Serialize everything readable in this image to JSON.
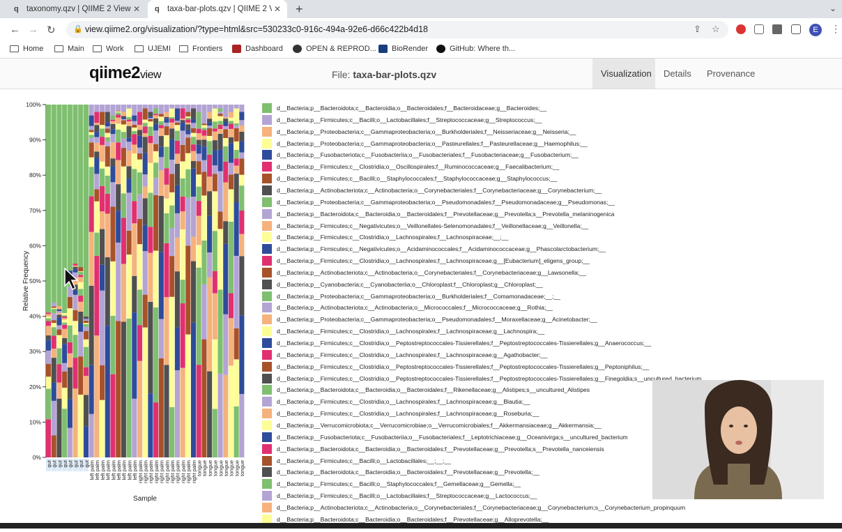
{
  "browser": {
    "tabs": [
      {
        "title": "taxonomy.qzv | QIIME 2 View",
        "icon": "q2-favicon"
      },
      {
        "title": "taxa-bar-plots.qzv | QIIME 2 Vi",
        "icon": "q2-favicon"
      }
    ],
    "url": "view.qiime2.org/visualization/?type=html&src=530233c0-916c-494a-92e6-d66c422b4d18",
    "profile_initial": "E",
    "bookmarks": [
      "Home",
      "Main",
      "Work",
      "UJEMI",
      "Frontiers",
      "Dashboard",
      "OPEN & REPROD...",
      "BioRender",
      "GitHub: Where th..."
    ]
  },
  "qiime": {
    "logo_main": "qiime2",
    "logo_sub": "view",
    "file_prefix": "File:",
    "file_name": "taxa-bar-plots.qzv",
    "nav": [
      "Visualization",
      "Details",
      "Provenance"
    ]
  },
  "chart_data": {
    "type": "bar",
    "stacked": true,
    "xlabel": "Sample",
    "ylabel": "Relative Frequency",
    "yticks": [
      "0%",
      "10%",
      "20%",
      "30%",
      "40%",
      "50%",
      "60%",
      "70%",
      "80%",
      "90%",
      "100%"
    ],
    "ylim": [
      0,
      100
    ],
    "categories": [
      "gut",
      "gut",
      "gut",
      "gut",
      "gut",
      "gut",
      "gut",
      "gut",
      "left palm",
      "left palm",
      "left palm",
      "left palm",
      "left palm",
      "left palm",
      "left palm",
      "left palm",
      "left palm",
      "right palm",
      "right palm",
      "right palm",
      "right palm",
      "right palm",
      "right palm",
      "right palm",
      "right palm",
      "right palm",
      "right palm",
      "right palm",
      "tongue",
      "tongue",
      "tongue",
      "tongue",
      "tongue",
      "tongue",
      "tongue",
      "tongue",
      "tongue"
    ],
    "top_taxon_share": [
      58,
      56,
      57,
      59,
      47,
      45,
      46,
      60,
      3,
      2,
      2,
      2,
      3,
      1,
      2,
      1,
      3,
      2,
      1,
      2,
      1,
      1,
      2,
      1,
      1,
      1,
      2,
      1,
      2,
      4,
      2,
      1,
      1,
      1,
      2,
      1,
      2
    ]
  },
  "legend": [
    {
      "color": "#7fbf6f",
      "label": "d__Bacteria;p__Bacteroidota;c__Bacteroidia;o__Bacteroidales;f__Bacteroidaceae;g__Bacteroides;__"
    },
    {
      "color": "#b3a4d4",
      "label": "d__Bacteria;p__Firmicutes;c__Bacilli;o__Lactobacillales;f__Streptococcaceae;g__Streptococcus;__"
    },
    {
      "color": "#f5b27c",
      "label": "d__Bacteria;p__Proteobacteria;c__Gammaproteobacteria;o__Burkholderiales;f__Neisseriaceae;g__Neisseria;__"
    },
    {
      "color": "#fdfd96",
      "label": "d__Bacteria;p__Proteobacteria;c__Gammaproteobacteria;o__Pasteurellales;f__Pasteurellaceae;g__Haemophilus;__"
    },
    {
      "color": "#2f4b9b",
      "label": "d__Bacteria;p__Fusobacteriota;c__Fusobacteriia;o__Fusobacteriales;f__Fusobacteriaceae;g__Fusobacterium;__"
    },
    {
      "color": "#e03070",
      "label": "d__Bacteria;p__Firmicutes;c__Clostridia;o__Oscillospirales;f__Ruminococcaceae;g__Faecalibacterium;__"
    },
    {
      "color": "#a8522a",
      "label": "d__Bacteria;p__Firmicutes;c__Bacilli;o__Staphylococcales;f__Staphylococcaceae;g__Staphylococcus;__"
    },
    {
      "color": "#505050",
      "label": "d__Bacteria;p__Actinobacteriota;c__Actinobacteria;o__Corynebacteriales;f__Corynebacteriaceae;g__Corynebacterium;__"
    },
    {
      "color": "#7fbf6f",
      "label": "d__Bacteria;p__Proteobacteria;c__Gammaproteobacteria;o__Pseudomonadales;f__Pseudomonadaceae;g__Pseudomonas;__"
    },
    {
      "color": "#b3a4d4",
      "label": "d__Bacteria;p__Bacteroidota;c__Bacteroidia;o__Bacteroidales;f__Prevotellaceae;g__Prevotella;s__Prevotella_melaninogenica"
    },
    {
      "color": "#f5b27c",
      "label": "d__Bacteria;p__Firmicutes;c__Negativicutes;o__Veillonellales-Selenomonadales;f__Veillonellaceae;g__Veillonella;__"
    },
    {
      "color": "#fdfd96",
      "label": "d__Bacteria;p__Firmicutes;c__Clostridia;o__Lachnospirales;f__Lachnospiraceae;__;__"
    },
    {
      "color": "#2f4b9b",
      "label": "d__Bacteria;p__Firmicutes;c__Negativicutes;o__Acidaminococcales;f__Acidaminococcaceae;g__Phascolarctobacterium;__"
    },
    {
      "color": "#e03070",
      "label": "d__Bacteria;p__Firmicutes;c__Clostridia;o__Lachnospirales;f__Lachnospiraceae;g__[Eubacterium]_eligens_group;__"
    },
    {
      "color": "#a8522a",
      "label": "d__Bacteria;p__Actinobacteriota;c__Actinobacteria;o__Corynebacteriales;f__Corynebacteriaceae;g__Lawsonella;__"
    },
    {
      "color": "#505050",
      "label": "d__Bacteria;p__Cyanobacteria;c__Cyanobacteriia;o__Chloroplast;f__Chloroplast;g__Chloroplast;__"
    },
    {
      "color": "#7fbf6f",
      "label": "d__Bacteria;p__Proteobacteria;c__Gammaproteobacteria;o__Burkholderiales;f__Comamonadaceae;__;__"
    },
    {
      "color": "#b3a4d4",
      "label": "d__Bacteria;p__Actinobacteriota;c__Actinobacteria;o__Micrococcales;f__Micrococcaceae;g__Rothia;__"
    },
    {
      "color": "#f5b27c",
      "label": "d__Bacteria;p__Proteobacteria;c__Gammaproteobacteria;o__Pseudomonadales;f__Moraxellaceae;g__Acinetobacter;__"
    },
    {
      "color": "#fdfd96",
      "label": "d__Bacteria;p__Firmicutes;c__Clostridia;o__Lachnospirales;f__Lachnospiraceae;g__Lachnospira;__"
    },
    {
      "color": "#2f4b9b",
      "label": "d__Bacteria;p__Firmicutes;c__Clostridia;o__Peptostreptococcales-Tissierellales;f__Peptostreptococcales-Tissierellales;g__Anaerococcus;__"
    },
    {
      "color": "#e03070",
      "label": "d__Bacteria;p__Firmicutes;c__Clostridia;o__Lachnospirales;f__Lachnospiraceae;g__Agathobacter;__"
    },
    {
      "color": "#a8522a",
      "label": "d__Bacteria;p__Firmicutes;c__Clostridia;o__Peptostreptococcales-Tissierellales;f__Peptostreptococcales-Tissierellales;g__Peptoniphilus;__"
    },
    {
      "color": "#505050",
      "label": "d__Bacteria;p__Firmicutes;c__Clostridia;o__Peptostreptococcales-Tissierellales;f__Peptostreptococcales-Tissierellales;g__Finegoldia;s__uncultured_bacterium"
    },
    {
      "color": "#7fbf6f",
      "label": "d__Bacteria;p__Bacteroidota;c__Bacteroidia;o__Bacteroidales;f__Rikenellaceae;g__Alistipes;s__uncultured_Alistipes"
    },
    {
      "color": "#b3a4d4",
      "label": "d__Bacteria;p__Firmicutes;c__Clostridia;o__Lachnospirales;f__Lachnospiraceae;g__Blautia;__"
    },
    {
      "color": "#f5b27c",
      "label": "d__Bacteria;p__Firmicutes;c__Clostridia;o__Lachnospirales;f__Lachnospiraceae;g__Roseburia;__"
    },
    {
      "color": "#fdfd96",
      "label": "d__Bacteria;p__Verrucomicrobiota;c__Verrucomicrobiae;o__Verrucomicrobiales;f__Akkermansiaceae;g__Akkermansia;__"
    },
    {
      "color": "#2f4b9b",
      "label": "d__Bacteria;p__Fusobacteriota;c__Fusobacteriia;o__Fusobacteriales;f__Leptotrichiaceae;g__Oceanivirga;s__uncultured_bacterium"
    },
    {
      "color": "#e03070",
      "label": "d__Bacteria;p__Bacteroidota;c__Bacteroidia;o__Bacteroidales;f__Prevotellaceae;g__Prevotella;s__Prevotella_nanceiensis"
    },
    {
      "color": "#a8522a",
      "label": "d__Bacteria;p__Firmicutes;c__Bacilli;o__Lactobacillales;__;__;__"
    },
    {
      "color": "#505050",
      "label": "d__Bacteria;p__Bacteroidota;c__Bacteroidia;o__Bacteroidales;f__Prevotellaceae;g__Prevotella;__"
    },
    {
      "color": "#7fbf6f",
      "label": "d__Bacteria;p__Firmicutes;c__Bacilli;o__Staphylococcales;f__Gemellaceae;g__Gemella;__"
    },
    {
      "color": "#b3a4d4",
      "label": "d__Bacteria;p__Firmicutes;c__Bacilli;o__Lactobacillales;f__Streptococcaceae;g__Lactococcus;__"
    },
    {
      "color": "#f5b27c",
      "label": "d__Bacteria;p__Actinobacteriota;c__Actinobacteria;o__Corynebacteriales;f__Corynebacteriaceae;g__Corynebacterium;s__Corynebacterium_propinquum"
    },
    {
      "color": "#fdfd96",
      "label": "d__Bacteria;p__Bacteroidota;c__Bacteroidia;o__Bacteroidales;f__Prevotellaceae;g__Alloprevotella;__"
    }
  ]
}
